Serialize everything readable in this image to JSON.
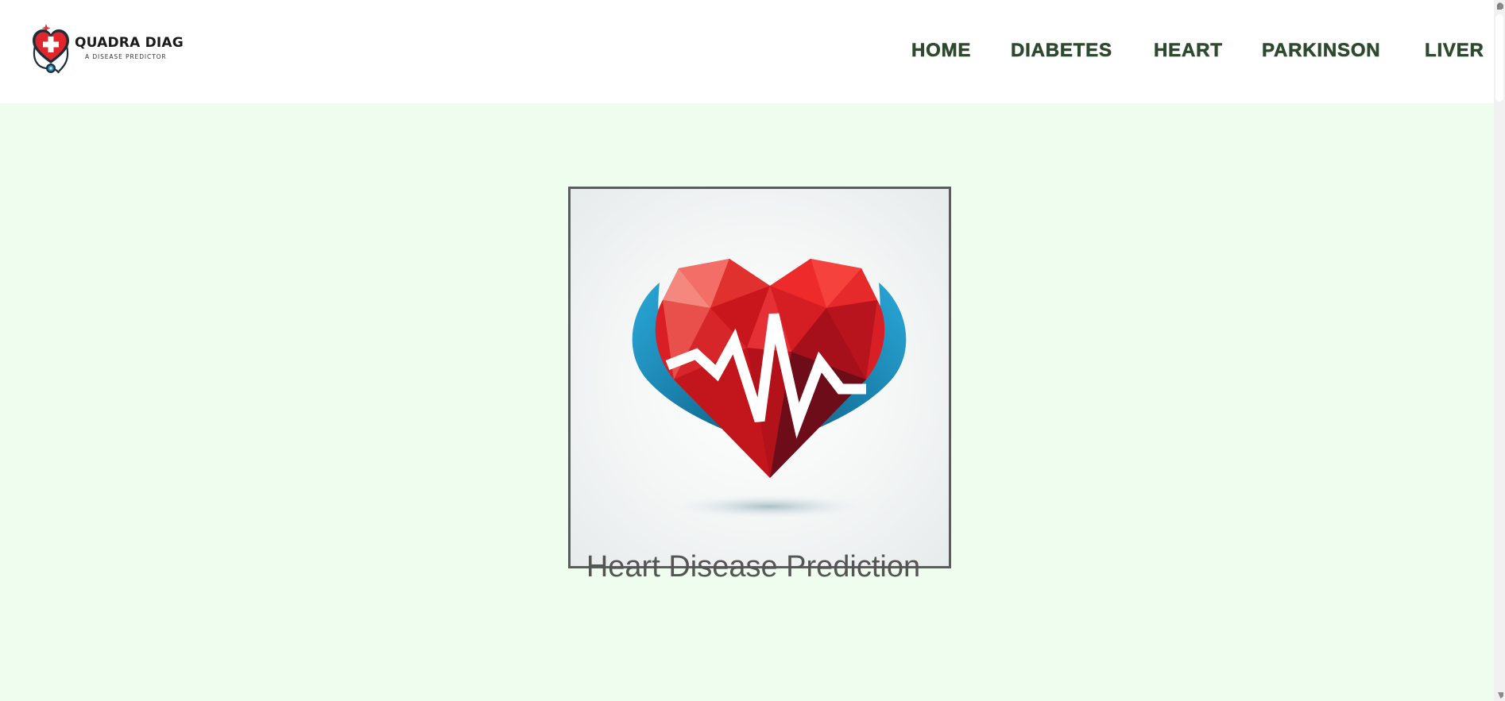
{
  "header": {
    "logo": {
      "title": "QUADRA DIAG",
      "subtitle": "A DISEASE PREDICTOR",
      "icon": "heart-cross-stethoscope-icon"
    },
    "nav": [
      {
        "label": "HOME",
        "id": "home"
      },
      {
        "label": "DIABETES",
        "id": "diabetes"
      },
      {
        "label": "HEART",
        "id": "heart"
      },
      {
        "label": "PARKINSON",
        "id": "parkinson"
      },
      {
        "label": "LIVER",
        "id": "liver"
      }
    ]
  },
  "main": {
    "hero_image": "heart-pulse-illustration",
    "heading": "Heart Disease Prediction"
  },
  "colors": {
    "nav_text": "#2e4a2e",
    "page_background": "#effdef",
    "header_background": "#ffffff",
    "heading_text": "#555555",
    "image_border": "#5c5c5c",
    "heart_red": "#e0262b",
    "heart_blue": "#1a86b3"
  }
}
